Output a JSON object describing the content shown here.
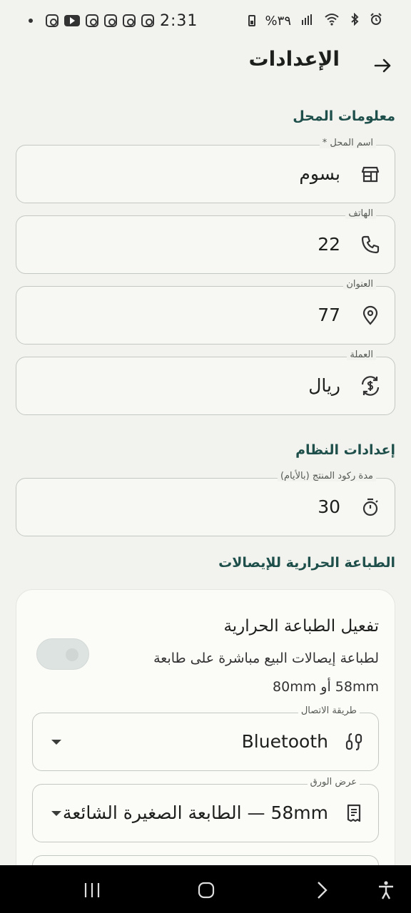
{
  "status_bar": {
    "time": "2:31",
    "battery_text": "%٣٩",
    "notification_icons": [
      "instagram-icon",
      "youtube-icon",
      "instagram-icon",
      "instagram-icon",
      "instagram-icon",
      "instagram-icon"
    ]
  },
  "app_bar": {
    "title": "الإعدادات",
    "back_icon": "arrow-back-icon"
  },
  "shop_info": {
    "section_title": "معلومات المحل",
    "fields": [
      {
        "label": "اسم المحل *",
        "value": "بسوم",
        "icon": "store-icon"
      },
      {
        "label": "الهاتف",
        "value": "22",
        "icon": "phone-icon"
      },
      {
        "label": "العنوان",
        "value": "77",
        "icon": "location-pin-icon"
      },
      {
        "label": "العملة",
        "value": "ريال",
        "icon": "currency-exchange-icon"
      }
    ]
  },
  "system_settings": {
    "section_title": "إعدادات النظام",
    "stagnation_field": {
      "label": "مدة ركود المنتج (بالأيام)",
      "value": "30",
      "icon": "timer-icon"
    }
  },
  "printer": {
    "section_title": "الطباعة الحرارية للإيصالات",
    "toggle_title": "تفعيل الطباعة الحرارية",
    "toggle_description": "لطباعة إيصالات البيع مباشرة على طابعة 58mm أو 80mm",
    "toggle_on": false,
    "connection": {
      "label": "طريقة الاتصال",
      "value": "Bluetooth",
      "icon": "bluetooth-connection-icon"
    },
    "paper_width": {
      "label": "عرض الورق",
      "value": "58mm — الطابعة الصغيرة الشائعة",
      "icon": "receipt-icon"
    }
  },
  "colors": {
    "background": "#f2f3ef",
    "section_title": "#1f4f4a",
    "field_border": "#c4c8c2",
    "nav_bar": "#000000"
  }
}
